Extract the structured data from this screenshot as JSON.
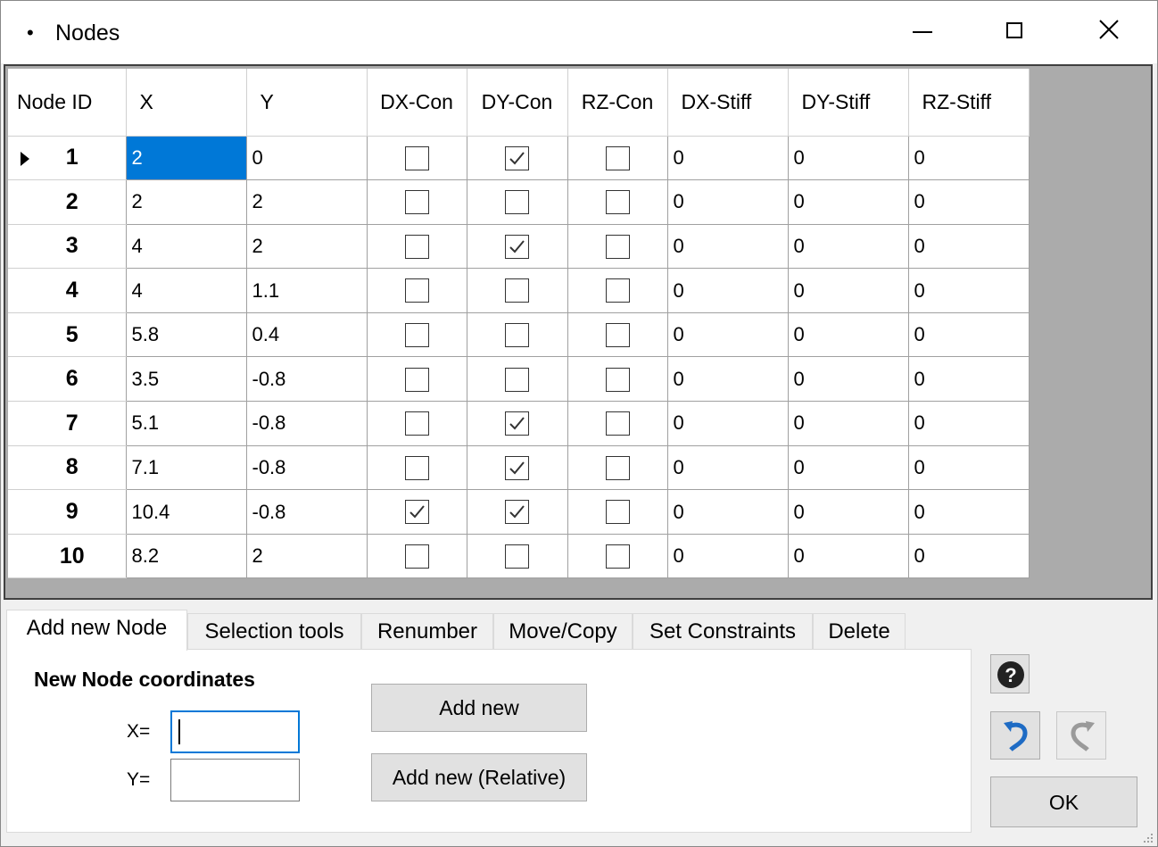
{
  "window": {
    "title": "Nodes",
    "icon": "bullet-icon",
    "controls": [
      "minimize-icon",
      "maximize-icon",
      "close-icon"
    ]
  },
  "grid": {
    "columns": [
      "Node ID",
      "X",
      "Y",
      "DX-Con",
      "DY-Con",
      "RZ-Con",
      "DX-Stiff",
      "DY-Stiff",
      "RZ-Stiff"
    ],
    "rows": [
      {
        "id": "1",
        "x": "2",
        "y": "0",
        "dx_con": false,
        "dy_con": true,
        "rz_con": false,
        "dx_stiff": "0",
        "dy_stiff": "0",
        "rz_stiff": "0"
      },
      {
        "id": "2",
        "x": "2",
        "y": "2",
        "dx_con": false,
        "dy_con": false,
        "rz_con": false,
        "dx_stiff": "0",
        "dy_stiff": "0",
        "rz_stiff": "0"
      },
      {
        "id": "3",
        "x": "4",
        "y": "2",
        "dx_con": false,
        "dy_con": true,
        "rz_con": false,
        "dx_stiff": "0",
        "dy_stiff": "0",
        "rz_stiff": "0"
      },
      {
        "id": "4",
        "x": "4",
        "y": "1.1",
        "dx_con": false,
        "dy_con": false,
        "rz_con": false,
        "dx_stiff": "0",
        "dy_stiff": "0",
        "rz_stiff": "0"
      },
      {
        "id": "5",
        "x": "5.8",
        "y": "0.4",
        "dx_con": false,
        "dy_con": false,
        "rz_con": false,
        "dx_stiff": "0",
        "dy_stiff": "0",
        "rz_stiff": "0"
      },
      {
        "id": "6",
        "x": "3.5",
        "y": "-0.8",
        "dx_con": false,
        "dy_con": false,
        "rz_con": false,
        "dx_stiff": "0",
        "dy_stiff": "0",
        "rz_stiff": "0"
      },
      {
        "id": "7",
        "x": "5.1",
        "y": "-0.8",
        "dx_con": false,
        "dy_con": true,
        "rz_con": false,
        "dx_stiff": "0",
        "dy_stiff": "0",
        "rz_stiff": "0"
      },
      {
        "id": "8",
        "x": "7.1",
        "y": "-0.8",
        "dx_con": false,
        "dy_con": true,
        "rz_con": false,
        "dx_stiff": "0",
        "dy_stiff": "0",
        "rz_stiff": "0"
      },
      {
        "id": "9",
        "x": "10.4",
        "y": "-0.8",
        "dx_con": true,
        "dy_con": true,
        "rz_con": false,
        "dx_stiff": "0",
        "dy_stiff": "0",
        "rz_stiff": "0"
      },
      {
        "id": "10",
        "x": "8.2",
        "y": "2",
        "dx_con": false,
        "dy_con": false,
        "rz_con": false,
        "dx_stiff": "0",
        "dy_stiff": "0",
        "rz_stiff": "0"
      }
    ],
    "selected_row": 0,
    "selected_color": "#0078d7"
  },
  "tabs": [
    "Add new Node",
    "Selection tools",
    "Renumber",
    "Move/Copy",
    "Set Constraints",
    "Delete"
  ],
  "add_node": {
    "section_title": "New Node coordinates",
    "x_label": "X=",
    "y_label": "Y=",
    "x_value": "",
    "y_value": "",
    "add_button": "Add new",
    "add_relative_button": "Add new (Relative)"
  },
  "side_buttons": {
    "help_icon": "help-icon",
    "undo_icon": "undo-icon",
    "redo_icon": "redo-icon",
    "ok_label": "OK"
  }
}
